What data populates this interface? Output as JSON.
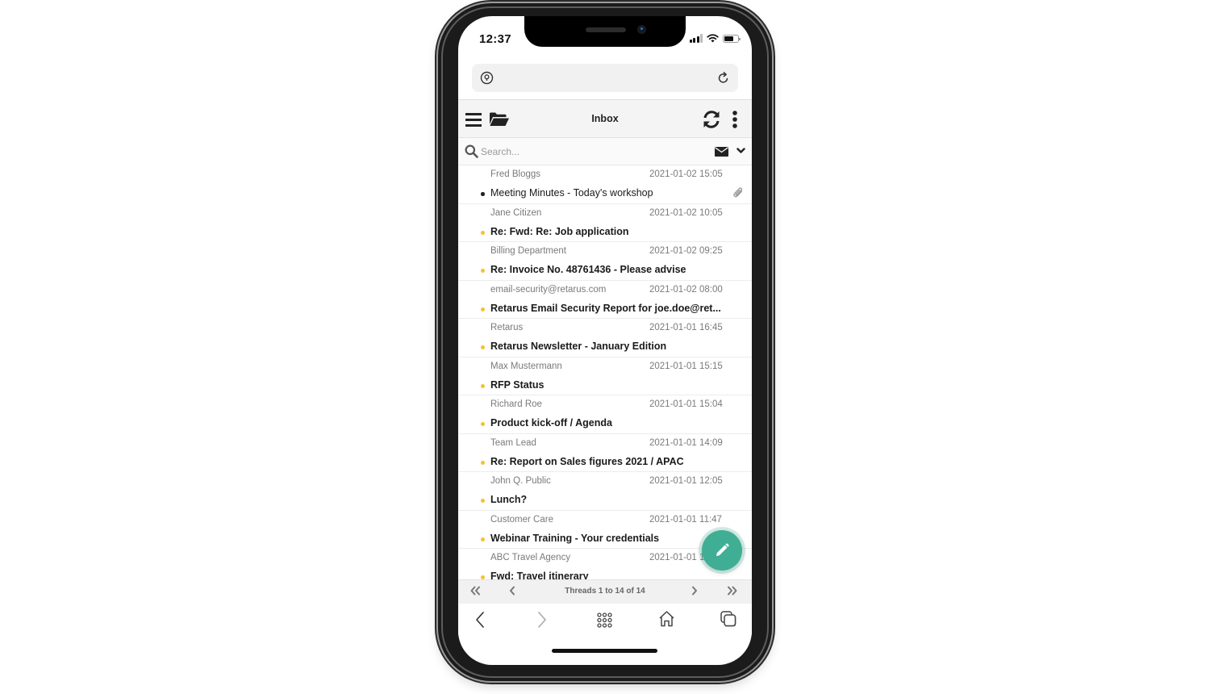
{
  "status_bar": {
    "time": "12:37",
    "icons": [
      "signal-icon",
      "wifi-icon",
      "battery-icon"
    ],
    "battery_level": 0.7
  },
  "browser": {
    "url_left_icon": "location-pin-icon",
    "url_right_icon": "reload-icon",
    "bottom_bar": [
      "back-icon",
      "forward-icon",
      "apps-grid-icon",
      "home-icon",
      "tabs-icon"
    ]
  },
  "toolbar": {
    "title": "Inbox",
    "left_icons": [
      "hamburger-menu-icon",
      "folder-open-icon"
    ],
    "right_icons": [
      "sync-icon",
      "more-vertical-icon"
    ]
  },
  "search": {
    "placeholder": "Search...",
    "value": "",
    "filter_icon": "envelope-icon",
    "dropdown_icon": "chevron-down-icon"
  },
  "colors": {
    "accent": "#3fae94",
    "unread_dot": "#f5c230",
    "read_dot": "#222222",
    "sender_text": "#7a7a7a",
    "toolbar_bg": "#f4f4f4"
  },
  "messages": [
    {
      "sender": "Fred Bloggs",
      "date": "2021-01-02 15:05",
      "subject": "Meeting Minutes - Today's workshop",
      "unread": false,
      "attachment": true
    },
    {
      "sender": "Jane Citizen",
      "date": "2021-01-02 10:05",
      "subject": "Re: Fwd: Re: Job application",
      "unread": true,
      "attachment": false
    },
    {
      "sender": "Billing Department",
      "date": "2021-01-02 09:25",
      "subject": "Re: Invoice No. 48761436 - Please advise",
      "unread": true,
      "attachment": false
    },
    {
      "sender": "email-security@retarus.com",
      "date": "2021-01-02 08:00",
      "subject": "Retarus Email Security Report for joe.doe@ret...",
      "unread": true,
      "attachment": false
    },
    {
      "sender": "Retarus",
      "date": "2021-01-01 16:45",
      "subject": "Retarus Newsletter - January Edition",
      "unread": true,
      "attachment": false
    },
    {
      "sender": "Max Mustermann",
      "date": "2021-01-01 15:15",
      "subject": "RFP Status",
      "unread": true,
      "attachment": false
    },
    {
      "sender": "Richard Roe",
      "date": "2021-01-01 15:04",
      "subject": "Product kick-off / Agenda",
      "unread": true,
      "attachment": false
    },
    {
      "sender": "Team Lead",
      "date": "2021-01-01 14:09",
      "subject": "Re: Report on Sales figures 2021 / APAC",
      "unread": true,
      "attachment": false
    },
    {
      "sender": "John Q. Public",
      "date": "2021-01-01 12:05",
      "subject": "Lunch?",
      "unread": true,
      "attachment": false
    },
    {
      "sender": "Customer Care",
      "date": "2021-01-01 11:47",
      "subject": "Webinar Training - Your credentials",
      "unread": true,
      "attachment": false
    },
    {
      "sender": "ABC Travel Agency",
      "date": "2021-01-01 1",
      "subject": "Fwd: Travel itinerary",
      "unread": true,
      "attachment": false
    }
  ],
  "pager": {
    "text": "Threads 1 to 14 of 14",
    "first_icon": "double-chevron-left-icon",
    "prev_icon": "chevron-left-icon",
    "next_icon": "chevron-right-icon",
    "last_icon": "double-chevron-right-icon"
  },
  "fab": {
    "icon": "pencil-icon",
    "action": "compose"
  }
}
